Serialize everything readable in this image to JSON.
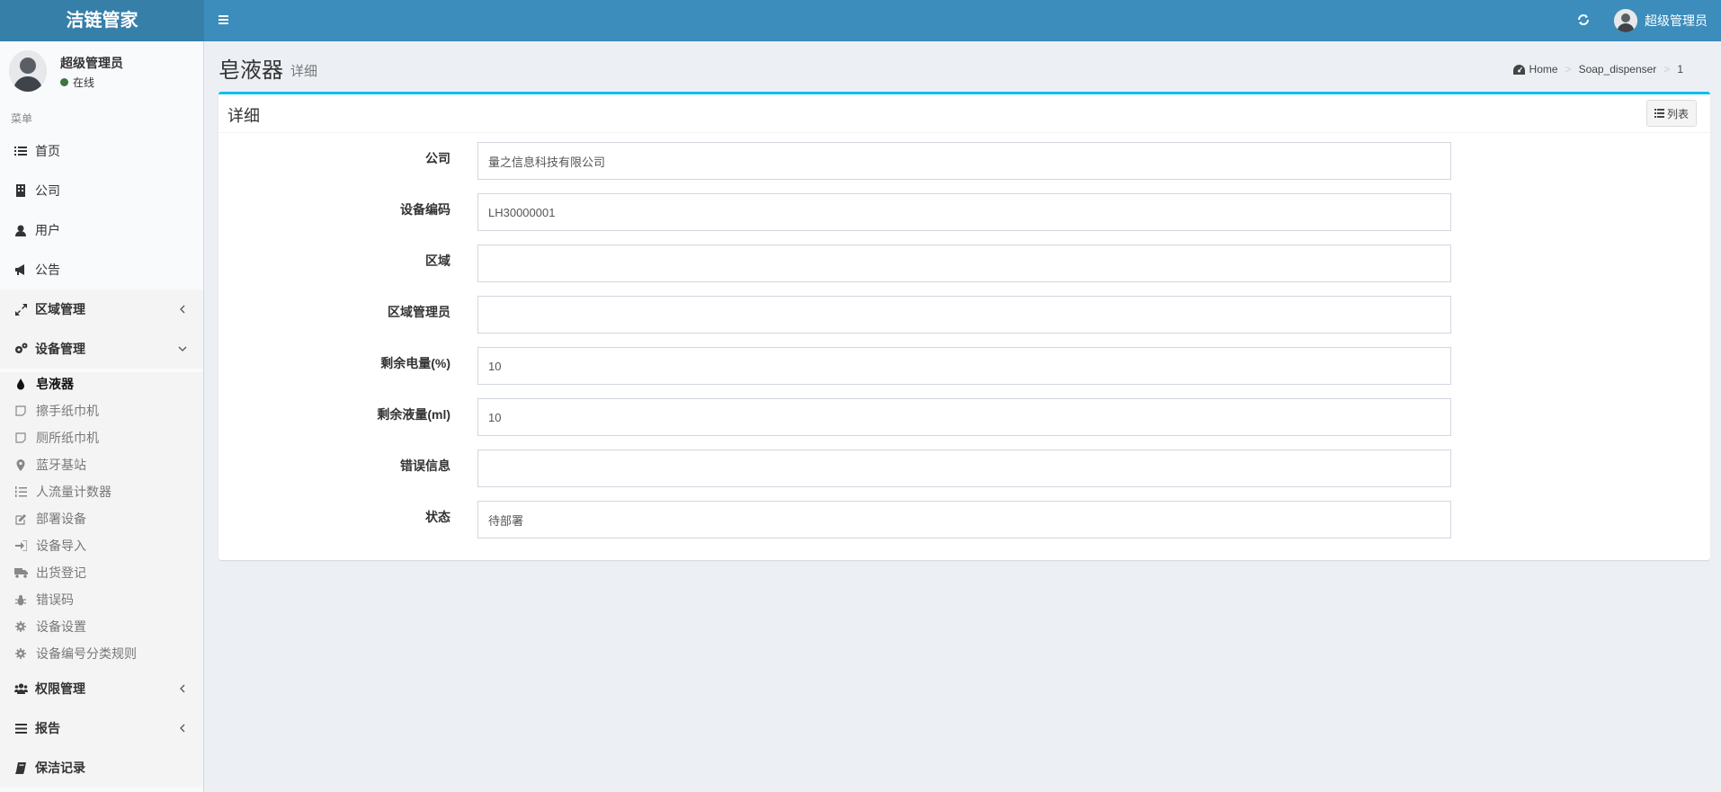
{
  "header": {
    "logo": "洁链管家",
    "user_name": "超级管理员",
    "colors": {
      "bar": "#3c8dbc",
      "logo_bg": "#367fa9"
    },
    "icons": {
      "toggle": "hamburger-icon",
      "refresh": "refresh-icon"
    }
  },
  "sidebar": {
    "user_name": "超级管理员",
    "status": "在线",
    "menu_header": "菜单",
    "items": [
      {
        "label": "首页",
        "icon": "list-icon"
      },
      {
        "label": "公司",
        "icon": "building-icon"
      },
      {
        "label": "用户",
        "icon": "user-icon"
      },
      {
        "label": "公告",
        "icon": "bullhorn-icon"
      },
      {
        "label": "区域管理",
        "icon": "expand-icon"
      },
      {
        "label": "设备管理",
        "icon": "cogs-icon"
      },
      {
        "label": "权限管理",
        "icon": "users-icon"
      },
      {
        "label": "报告",
        "icon": "bars-icon"
      },
      {
        "label": "保洁记录",
        "icon": "book-icon"
      }
    ],
    "submenu": [
      {
        "label": "皂液器",
        "icon": "tint-icon",
        "active": true
      },
      {
        "label": "擦手纸巾机",
        "icon": "sticky-note-icon"
      },
      {
        "label": "厕所纸巾机",
        "icon": "sticky-note-icon"
      },
      {
        "label": "蓝牙基站",
        "icon": "map-marker-icon"
      },
      {
        "label": "人流量计数器",
        "icon": "list-ol-icon"
      },
      {
        "label": "部署设备",
        "icon": "edit-icon"
      },
      {
        "label": "设备导入",
        "icon": "sign-in-icon"
      },
      {
        "label": "出货登记",
        "icon": "truck-icon"
      },
      {
        "label": "错误码",
        "icon": "bug-icon"
      },
      {
        "label": "设备设置",
        "icon": "cog-icon"
      },
      {
        "label": "设备编号分类规则",
        "icon": "cog-icon"
      }
    ]
  },
  "content": {
    "title": "皂液器",
    "subtitle": "详细",
    "breadcrumb": [
      "Home",
      "Soap_dispenser",
      "1"
    ],
    "box_title": "详细",
    "list_button": "列表",
    "fields": [
      {
        "label": "公司",
        "value": "量之信息科技有限公司"
      },
      {
        "label": "设备编码",
        "value": "LH30000001"
      },
      {
        "label": "区域",
        "value": ""
      },
      {
        "label": "区域管理员",
        "value": ""
      },
      {
        "label": "剩余电量(%)",
        "value": "10"
      },
      {
        "label": "剩余液量(ml)",
        "value": "10"
      },
      {
        "label": "错误信息",
        "value": ""
      },
      {
        "label": "状态",
        "value": "待部署"
      }
    ]
  }
}
